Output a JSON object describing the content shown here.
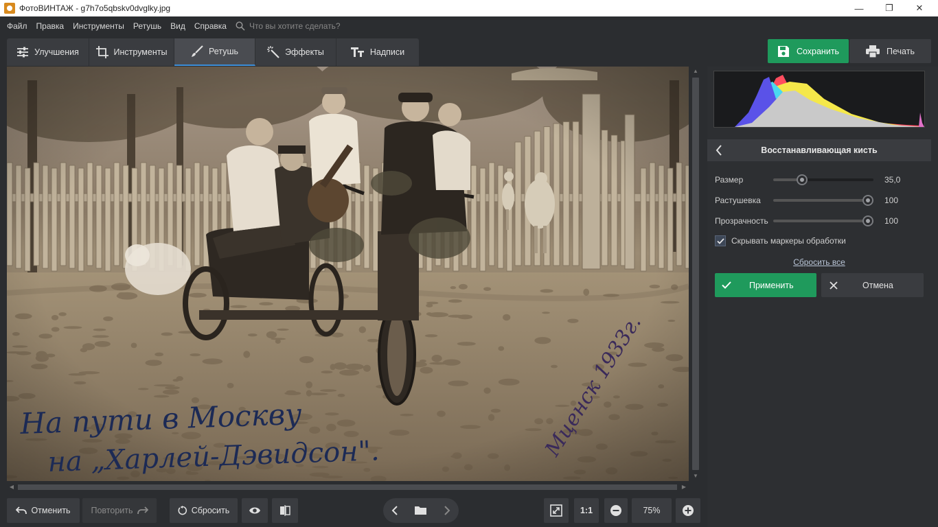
{
  "window": {
    "title": "ФотоВИНТАЖ - g7h7o5qbskv0dvglky.jpg",
    "minimize": "—",
    "maximize": "❐",
    "close": "✕"
  },
  "menu": {
    "items": [
      "Файл",
      "Правка",
      "Инструменты",
      "Ретушь",
      "Вид",
      "Справка"
    ],
    "search_placeholder": "Что вы хотите сделать?"
  },
  "tabs": [
    {
      "label": "Улучшения",
      "icon": "sliders-icon"
    },
    {
      "label": "Инструменты",
      "icon": "crop-icon"
    },
    {
      "label": "Ретушь",
      "icon": "brush-icon",
      "active": true
    },
    {
      "label": "Эффекты",
      "icon": "magic-wand-icon"
    },
    {
      "label": "Надписи",
      "icon": "text-icon"
    }
  ],
  "actions": {
    "save_label": "Сохранить",
    "print_label": "Печать"
  },
  "photo": {
    "inscription_line1": "На пути в Москву",
    "inscription_line2": "на „Харлей-Дэвидсон\".",
    "inscription_right": "Мценск 1933г."
  },
  "bottom": {
    "undo_label": "Отменить",
    "redo_label": "Повторить",
    "reset_label": "Сбросить",
    "ratio_label": "1:1",
    "zoom_value": "75%"
  },
  "panel": {
    "title": "Восстанавливающая кисть",
    "sliders": [
      {
        "label": "Размер",
        "value": "35,0",
        "fraction": 0.26
      },
      {
        "label": "Растушевка",
        "value": "100",
        "fraction": 1.0
      },
      {
        "label": "Прозрачность",
        "value": "100",
        "fraction": 1.0
      }
    ],
    "hide_markers_label": "Скрывать маркеры обработки",
    "hide_markers_checked": true,
    "reset_all_label": "Сбросить все",
    "apply_label": "Применить",
    "cancel_label": "Отмена"
  },
  "colors": {
    "accent_green": "#1f9a5c",
    "tab_active_underline": "#3d8fd9",
    "background": "#2b2d30"
  }
}
